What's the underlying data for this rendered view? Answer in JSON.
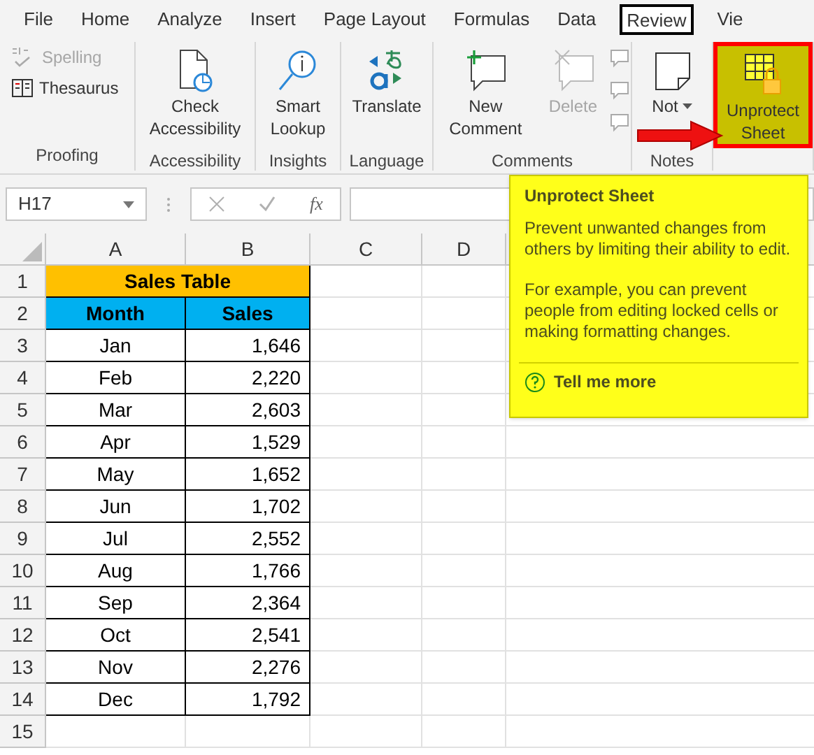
{
  "tabs": [
    {
      "label": "File",
      "selected": false
    },
    {
      "label": "Home",
      "selected": false
    },
    {
      "label": "Analyze",
      "selected": false
    },
    {
      "label": "Insert",
      "selected": false
    },
    {
      "label": "Page Layout",
      "selected": false
    },
    {
      "label": "Formulas",
      "selected": false
    },
    {
      "label": "Data",
      "selected": false
    },
    {
      "label": "Review",
      "selected": true
    },
    {
      "label": "Vie",
      "selected": false
    }
  ],
  "ribbon_groups": [
    {
      "label": "Proofing",
      "buttons": [
        {
          "kind": "small",
          "label": "Spelling",
          "disabled": true
        },
        {
          "kind": "small",
          "label": "Thesaurus",
          "disabled": false
        }
      ]
    },
    {
      "label": "Accessibility",
      "buttons": [
        {
          "kind": "large",
          "label": "Check Accessibility",
          "disabled": false
        }
      ]
    },
    {
      "label": "Insights",
      "buttons": [
        {
          "kind": "large",
          "label": "Smart Lookup",
          "disabled": false
        }
      ]
    },
    {
      "label": "Language",
      "buttons": [
        {
          "kind": "large",
          "label": "Translate",
          "disabled": false
        }
      ]
    },
    {
      "label": "Comments",
      "buttons": [
        {
          "kind": "large",
          "label": "New Comment",
          "disabled": false
        },
        {
          "kind": "large",
          "label": "Delete",
          "disabled": true
        },
        {
          "kind": "icons",
          "disabled": true
        }
      ]
    },
    {
      "label": "Notes",
      "buttons": [
        {
          "kind": "large",
          "label": "Not",
          "disabled": false
        }
      ]
    },
    {
      "buttons": [
        {
          "kind": "large",
          "label": "Unprotect Sheet",
          "disabled": false,
          "highlighted": true
        }
      ]
    }
  ],
  "formula_bar": {
    "name_box": "H17",
    "fx": "fx"
  },
  "sheet": {
    "columns": [
      "A",
      "B",
      "C",
      "D"
    ],
    "rows": [
      {
        "number": "1",
        "kind": "title",
        "cells": [
          "Sales Table"
        ]
      },
      {
        "number": "2",
        "kind": "header",
        "cells": [
          "Month",
          "Sales"
        ]
      },
      {
        "number": "3",
        "kind": "data",
        "cells": [
          "Jan",
          "1,646"
        ]
      },
      {
        "number": "4",
        "kind": "data",
        "cells": [
          "Feb",
          "2,220"
        ]
      },
      {
        "number": "5",
        "kind": "data",
        "cells": [
          "Mar",
          "2,603"
        ]
      },
      {
        "number": "6",
        "kind": "data",
        "cells": [
          "Apr",
          "1,529"
        ]
      },
      {
        "number": "7",
        "kind": "data",
        "cells": [
          "May",
          "1,652"
        ]
      },
      {
        "number": "8",
        "kind": "data",
        "cells": [
          "Jun",
          "1,702"
        ]
      },
      {
        "number": "9",
        "kind": "data",
        "cells": [
          "Jul",
          "2,552"
        ]
      },
      {
        "number": "10",
        "kind": "data",
        "cells": [
          "Aug",
          "1,766"
        ]
      },
      {
        "number": "11",
        "kind": "data",
        "cells": [
          "Sep",
          "2,364"
        ]
      },
      {
        "number": "12",
        "kind": "data",
        "cells": [
          "Oct",
          "2,541"
        ]
      },
      {
        "number": "13",
        "kind": "data",
        "cells": [
          "Nov",
          "2,276"
        ]
      },
      {
        "number": "14",
        "kind": "data",
        "cells": [
          "Dec",
          "1,792"
        ]
      },
      {
        "number": "15",
        "kind": "empty",
        "cells": []
      }
    ]
  },
  "tooltip": {
    "title": "Unprotect Sheet",
    "paragraphs": [
      "Prevent unwanted changes from others by limiting their ability to edit.",
      "For example, you can prevent people from editing locked cells or making formatting changes."
    ],
    "link": "Tell me more"
  }
}
